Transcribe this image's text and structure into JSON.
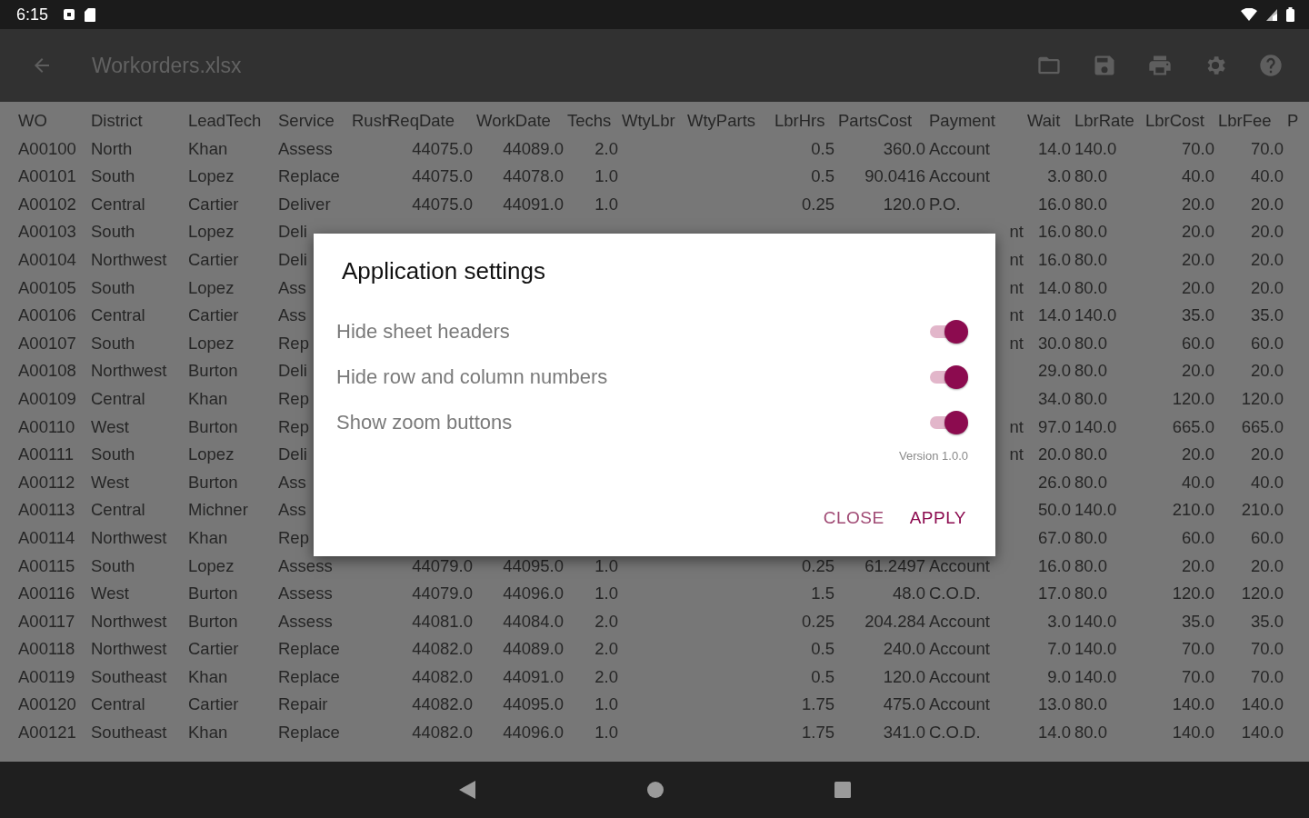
{
  "status_bar": {
    "time": "6:15"
  },
  "toolbar": {
    "title": "Workorders.xlsx"
  },
  "sheet": {
    "columns": [
      "WO",
      "District",
      "LeadTech",
      "Service",
      "Rush",
      "ReqDate",
      "WorkDate",
      "Techs",
      "WtyLbr",
      "WtyParts",
      "LbrHrs",
      "PartsCost",
      "Payment",
      "Wait",
      "LbrRate",
      "LbrCost",
      "LbrFee",
      "P"
    ],
    "rows": [
      [
        "A00100",
        "North",
        "Khan",
        "Assess",
        null,
        "44075.0",
        "44089.0",
        "2.0",
        null,
        null,
        "0.5",
        "360.0",
        "Account",
        "14.0",
        "140.0",
        "70.0",
        "70.0"
      ],
      [
        "A00101",
        "South",
        "Lopez",
        "Replace",
        null,
        "44075.0",
        "44078.0",
        "1.0",
        null,
        null,
        "0.5",
        "90.0416",
        "Account",
        "3.0",
        "80.0",
        "40.0",
        "40.0"
      ],
      [
        "A00102",
        "Central",
        "Cartier",
        "Deliver",
        null,
        "44075.0",
        "44091.0",
        "1.0",
        null,
        null,
        "0.25",
        "120.0",
        "P.O.",
        "16.0",
        "80.0",
        "20.0",
        "20.0"
      ],
      [
        "A00103",
        "South",
        "Lopez",
        "Deli",
        null,
        null,
        null,
        null,
        null,
        null,
        null,
        null,
        "nt",
        "16.0",
        "80.0",
        "20.0",
        "20.0"
      ],
      [
        "A00104",
        "Northwest",
        "Cartier",
        "Deli",
        null,
        null,
        null,
        null,
        null,
        null,
        null,
        null,
        "nt",
        "16.0",
        "80.0",
        "20.0",
        "20.0"
      ],
      [
        "A00105",
        "South",
        "Lopez",
        "Ass",
        null,
        null,
        null,
        null,
        null,
        null,
        null,
        null,
        "nt",
        "14.0",
        "80.0",
        "20.0",
        "20.0"
      ],
      [
        "A00106",
        "Central",
        "Cartier",
        "Ass",
        null,
        null,
        null,
        null,
        null,
        null,
        null,
        null,
        "nt",
        "14.0",
        "140.0",
        "35.0",
        "35.0"
      ],
      [
        "A00107",
        "South",
        "Lopez",
        "Rep",
        null,
        null,
        null,
        null,
        null,
        null,
        null,
        null,
        "nt",
        "30.0",
        "80.0",
        "60.0",
        "60.0"
      ],
      [
        "A00108",
        "Northwest",
        "Burton",
        "Deli",
        null,
        null,
        null,
        null,
        null,
        null,
        null,
        null,
        null,
        "29.0",
        "80.0",
        "20.0",
        "20.0"
      ],
      [
        "A00109",
        "Central",
        "Khan",
        "Rep",
        null,
        null,
        null,
        null,
        null,
        null,
        null,
        null,
        null,
        "34.0",
        "80.0",
        "120.0",
        "120.0"
      ],
      [
        "A00110",
        "West",
        "Burton",
        "Rep",
        null,
        null,
        null,
        null,
        null,
        null,
        null,
        null,
        "nt",
        "97.0",
        "140.0",
        "665.0",
        "665.0"
      ],
      [
        "A00111",
        "South",
        "Lopez",
        "Deli",
        null,
        null,
        null,
        null,
        null,
        null,
        null,
        null,
        "nt",
        "20.0",
        "80.0",
        "20.0",
        "20.0"
      ],
      [
        "A00112",
        "West",
        "Burton",
        "Ass",
        null,
        null,
        null,
        null,
        null,
        null,
        null,
        null,
        null,
        "26.0",
        "80.0",
        "40.0",
        "40.0"
      ],
      [
        "A00113",
        "Central",
        "Michner",
        "Ass",
        null,
        null,
        null,
        null,
        null,
        null,
        null,
        null,
        null,
        "50.0",
        "140.0",
        "210.0",
        "210.0"
      ],
      [
        "A00114",
        "Northwest",
        "Khan",
        "Rep",
        null,
        null,
        null,
        null,
        null,
        null,
        null,
        null,
        null,
        "67.0",
        "80.0",
        "60.0",
        "60.0"
      ],
      [
        "A00115",
        "South",
        "Lopez",
        "Assess",
        null,
        "44079.0",
        "44095.0",
        "1.0",
        null,
        null,
        "0.25",
        "61.2497",
        "Account",
        "16.0",
        "80.0",
        "20.0",
        "20.0"
      ],
      [
        "A00116",
        "West",
        "Burton",
        "Assess",
        null,
        "44079.0",
        "44096.0",
        "1.0",
        null,
        null,
        "1.5",
        "48.0",
        "C.O.D.",
        "17.0",
        "80.0",
        "120.0",
        "120.0"
      ],
      [
        "A00117",
        "Northwest",
        "Burton",
        "Assess",
        null,
        "44081.0",
        "44084.0",
        "2.0",
        null,
        null,
        "0.25",
        "204.284",
        "Account",
        "3.0",
        "140.0",
        "35.0",
        "35.0"
      ],
      [
        "A00118",
        "Northwest",
        "Cartier",
        "Replace",
        null,
        "44082.0",
        "44089.0",
        "2.0",
        null,
        null,
        "0.5",
        "240.0",
        "Account",
        "7.0",
        "140.0",
        "70.0",
        "70.0"
      ],
      [
        "A00119",
        "Southeast",
        "Khan",
        "Replace",
        null,
        "44082.0",
        "44091.0",
        "2.0",
        null,
        null,
        "0.5",
        "120.0",
        "Account",
        "9.0",
        "140.0",
        "70.0",
        "70.0"
      ],
      [
        "A00120",
        "Central",
        "Cartier",
        "Repair",
        null,
        "44082.0",
        "44095.0",
        "1.0",
        null,
        null,
        "1.75",
        "475.0",
        "Account",
        "13.0",
        "80.0",
        "140.0",
        "140.0"
      ],
      [
        "A00121",
        "Southeast",
        "Khan",
        "Replace",
        null,
        "44082.0",
        "44096.0",
        "1.0",
        null,
        null,
        "1.75",
        "341.0",
        "C.O.D.",
        "14.0",
        "80.0",
        "140.0",
        "140.0"
      ]
    ]
  },
  "dialog": {
    "title": "Application settings",
    "settings": [
      {
        "label": "Hide sheet headers",
        "on": true
      },
      {
        "label": "Hide row and column numbers",
        "on": true
      },
      {
        "label": "Show zoom buttons",
        "on": true
      }
    ],
    "version": "Version 1.0.0",
    "buttons": [
      {
        "label": "CLOSE"
      },
      {
        "label": "APPLY"
      }
    ]
  }
}
